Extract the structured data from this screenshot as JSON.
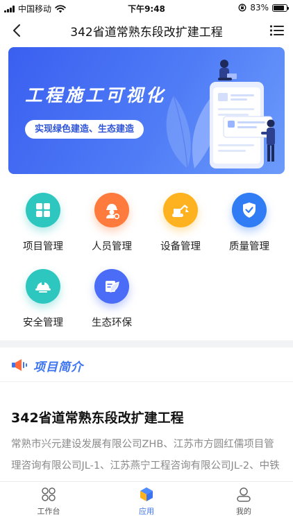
{
  "status_bar": {
    "carrier": "中国移动",
    "time": "下午9:48",
    "battery_percent": "83%",
    "battery_level": 0.83
  },
  "nav": {
    "title": "342省道常熟东段改扩建工程"
  },
  "banner": {
    "title": "工程施工可视化",
    "subtitle": "实现绿色建造、生态建造"
  },
  "grid": [
    {
      "label": "项目管理",
      "icon": "grid-squares-icon",
      "color": "#2ec7c0"
    },
    {
      "label": "人员管理",
      "icon": "worker-icon",
      "color": "#ff7a3d"
    },
    {
      "label": "设备管理",
      "icon": "excavator-icon",
      "color": "#ffb21f"
    },
    {
      "label": "质量管理",
      "icon": "shield-check-icon",
      "color": "#2f7cf5"
    },
    {
      "label": "安全管理",
      "icon": "safety-helmet-icon",
      "color": "#2ec7c0"
    },
    {
      "label": "生态环保",
      "icon": "leaf-icon",
      "color": "#4a6cf7"
    }
  ],
  "section": {
    "title": "项目简介"
  },
  "project": {
    "title": "342省道常熟东段改扩建工程",
    "description": "常熟市兴元建设发展有限公司ZHB、江苏市方圆红儒项目管理咨询有限公司JL-1、江苏燕宁工程咨询有限公司JL-2、中铁八局集团有限公司常熟市古田产业园"
  },
  "tabs": [
    {
      "label": "工作台",
      "icon": "workbench-icon",
      "active": false
    },
    {
      "label": "应用",
      "icon": "apps-cube-icon",
      "active": true
    },
    {
      "label": "我的",
      "icon": "user-icon",
      "active": false
    }
  ],
  "colors": {
    "accent": "#3b73f0",
    "banner_start": "#3a5ff0",
    "banner_end": "#6c9bfb"
  }
}
